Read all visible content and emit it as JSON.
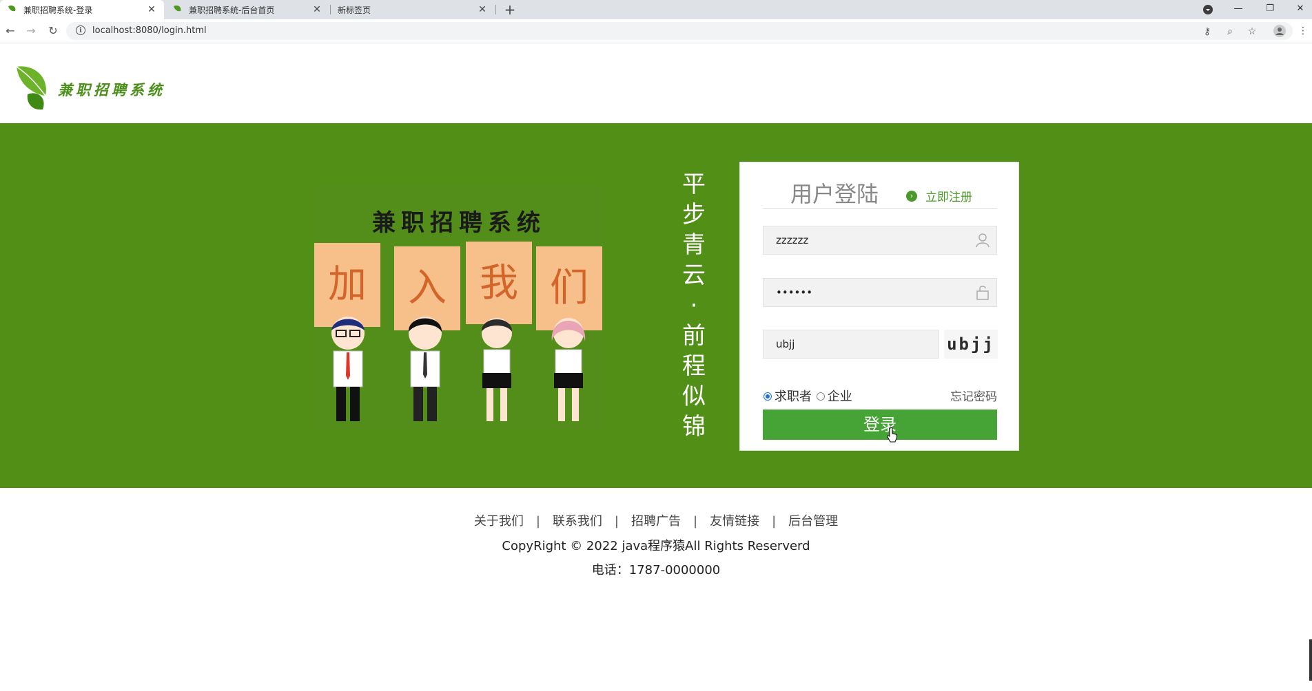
{
  "browser": {
    "tabs": [
      {
        "title": "兼职招聘系统-登录",
        "active": true
      },
      {
        "title": "兼职招聘系统-后台首页",
        "active": false
      },
      {
        "title": "新标签页",
        "active": false
      }
    ],
    "new_tab": "+",
    "url": "localhost:8080/login.html"
  },
  "header": {
    "logo_text": "兼职招聘系统"
  },
  "promo": {
    "title": "兼职招聘系统",
    "signs": [
      "加",
      "入",
      "我",
      "们"
    ]
  },
  "slogan": [
    "平",
    "步",
    "青",
    "云",
    "·",
    "前",
    "程",
    "似",
    "锦"
  ],
  "login": {
    "title": "用户登陆",
    "register_link": "立即注册",
    "username_value": "zzzzzz",
    "password_value": "••••••",
    "captcha_input_value": "ubjj",
    "captcha_image_text": "ubjj",
    "roles": [
      {
        "label": "求职者",
        "checked": true
      },
      {
        "label": "企业",
        "checked": false
      }
    ],
    "forgot_password": "忘记密码",
    "submit_label": "登录"
  },
  "footer": {
    "links": [
      "关于我们",
      "联系我们",
      "招聘广告",
      "友情链接",
      "后台管理"
    ],
    "copyright": "CopyRight © 2022 java程序猿All Rights Reserverd",
    "phone": "电话：1787-0000000"
  },
  "colors": {
    "banner_green": "#528f16",
    "button_green": "#46a335",
    "link_green": "#4a9a2a"
  }
}
